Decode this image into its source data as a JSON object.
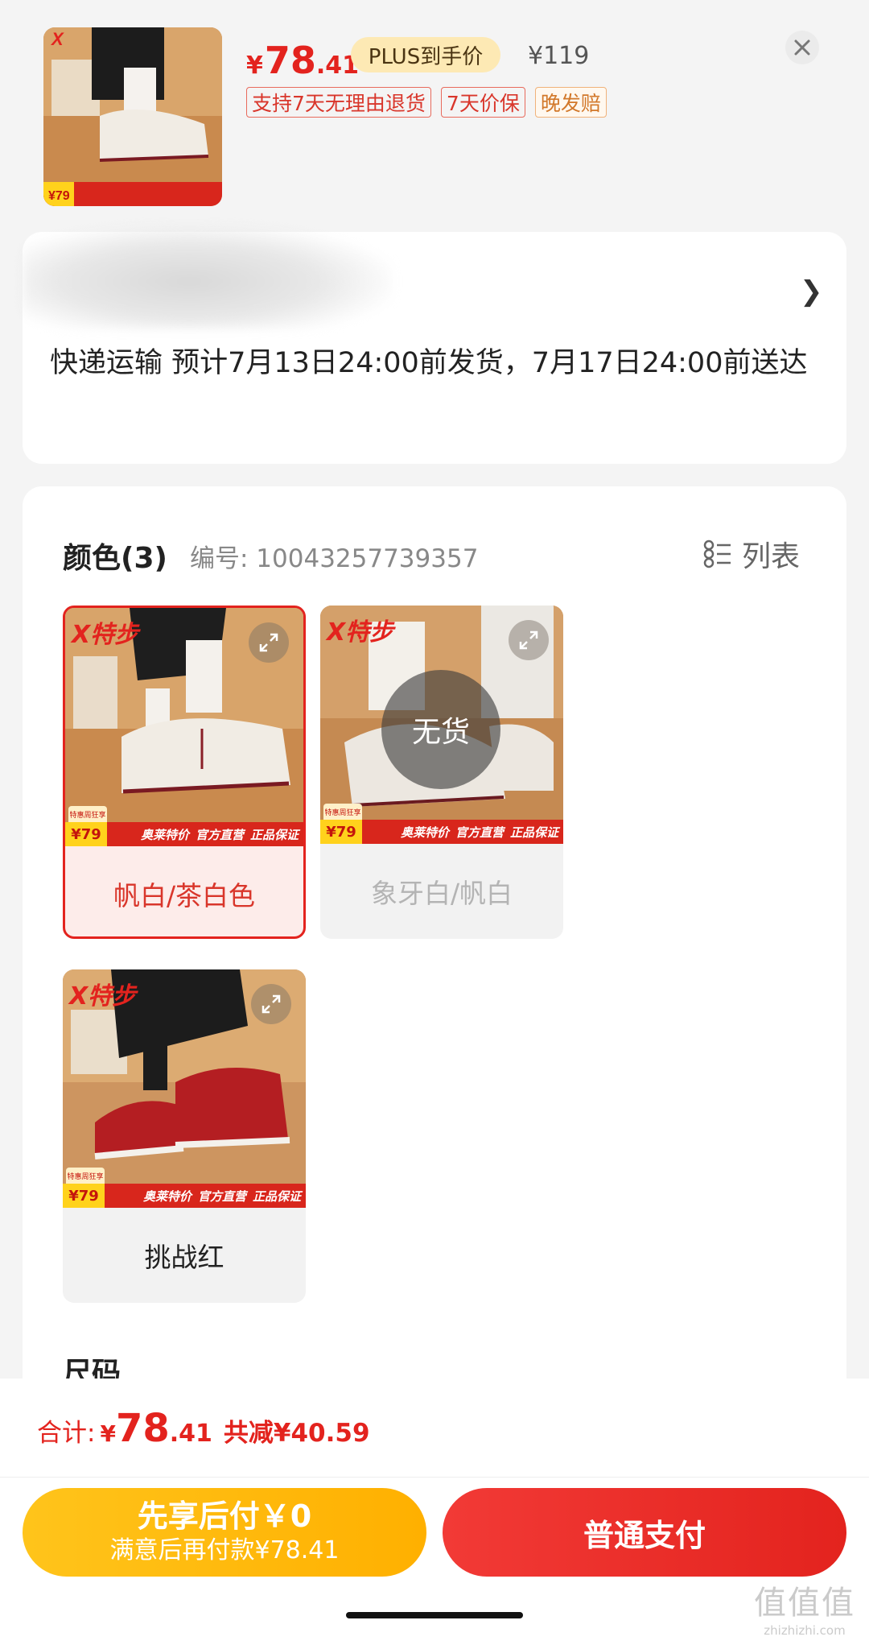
{
  "header": {
    "price": {
      "yen": "¥",
      "int": "78",
      "dec": ".41"
    },
    "plus_badge": "PLUS到手价",
    "original_price": "¥119",
    "tags": [
      {
        "label": "支持7天无理由退货",
        "style": "red"
      },
      {
        "label": "7天价保",
        "style": "red"
      },
      {
        "label": "晚发赔",
        "style": "orange"
      }
    ],
    "close_icon": "close-icon"
  },
  "delivery": {
    "address_blurred": true,
    "text": "快递运输 预计7月13日24:00前发货，7月17日24:00前送达"
  },
  "spec": {
    "color_title": "颜色(3)",
    "sku": "编号: 10043257739357",
    "list_toggle": "列表",
    "promo": {
      "price": "¥79",
      "gift": "特惠周狂享",
      "items": [
        "奥莱特价",
        "官方直营",
        "正品保证"
      ],
      "brand": "X特步"
    },
    "options": [
      {
        "label": "帆白/茶白色",
        "state": "selected",
        "shoe_color": "#f2ede6",
        "bg": "#c98a4e"
      },
      {
        "label": "象牙白/帆白",
        "state": "soldout",
        "soldout_text": "无货",
        "shoe_color": "#ece7e0",
        "bg": "#c58a52"
      },
      {
        "label": "挑战红",
        "state": "normal",
        "shoe_color": "#b41e22",
        "bg": "#cd9560"
      }
    ],
    "size_title": "尺码"
  },
  "footer": {
    "total_label": "合计:",
    "total": {
      "yen": "¥",
      "int": "78",
      "dec": ".41"
    },
    "reduce": "共减¥40.59",
    "later_pay": {
      "title": "先享后付￥0",
      "subtitle": "满意后再付款¥78.41"
    },
    "pay_button": "普通支付"
  },
  "watermark": {
    "glyphs": "值值值",
    "site": "zhizhizhi.com"
  },
  "colors": {
    "accent": "#e3231e",
    "gold": "#ffb000",
    "plus_bg": "#fde9b4"
  }
}
